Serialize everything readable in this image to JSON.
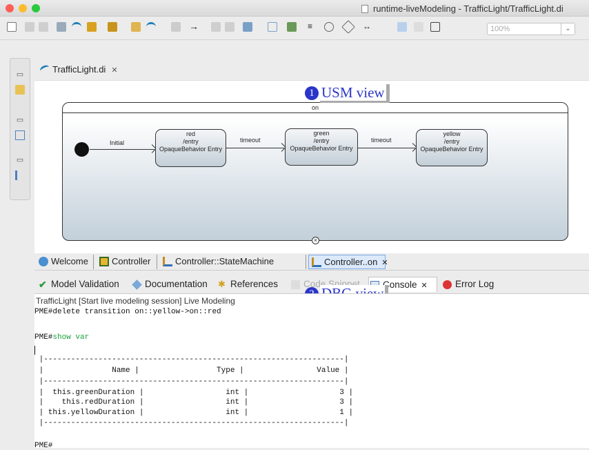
{
  "window": {
    "title": "runtime-liveModeling - TrafficLight/TrafficLight.di"
  },
  "window_controls": [
    {
      "name": "close",
      "color": "#fc5f57"
    },
    {
      "name": "minimize",
      "color": "#fdbc2e"
    },
    {
      "name": "maximize",
      "color": "#29c940"
    }
  ],
  "toolbar": {
    "zoom_value": "100%",
    "icons": [
      "new-icon",
      "save-icon",
      "save-all-icon",
      "edit-icon",
      "papyrus-icon",
      "diagram-icon",
      "table-icon",
      "view-icon",
      "papyrus-icon",
      "undo-icon",
      "arrow-icon",
      "copy-icon",
      "paste-icon",
      "layout-icon",
      "align-icon",
      "distribute-icon",
      "line-icon",
      "route-icon",
      "route-style-icon",
      "resize-icon",
      "color-icon",
      "font-icon",
      "grid-icon"
    ]
  },
  "sidebar": {
    "icons": [
      "restore-icon",
      "folder-icon",
      "restore-icon",
      "tree-icon",
      "restore-icon",
      "outline-icon"
    ]
  },
  "editor": {
    "tab_label": "TrafficLight.di"
  },
  "diagram": {
    "region_label": "on",
    "initial_label": "Initial",
    "transitions": [
      "timeout",
      "timeout"
    ],
    "states": [
      {
        "name": "red",
        "entry": "/entry",
        "behavior": "OpaqueBehavior Entry"
      },
      {
        "name": "green",
        "entry": "/entry",
        "behavior": "OpaqueBehavior Entry"
      },
      {
        "name": "yellow",
        "entry": "/entry",
        "behavior": "OpaqueBehavior Entry"
      }
    ]
  },
  "annotations": [
    {
      "number": "1",
      "label": "USM view"
    },
    {
      "number": "2",
      "label": "DBG view"
    }
  ],
  "editor_tabs": [
    {
      "label": "Welcome",
      "icon": "welcome-icon"
    },
    {
      "label": "Controller",
      "icon": "class-diagram-icon"
    },
    {
      "label": "Controller::StateMachine",
      "icon": "state-machine-icon"
    },
    {
      "label": "Controller..on",
      "icon": "state-machine-icon",
      "active": true
    }
  ],
  "view_tabs": [
    {
      "label": "Model Validation",
      "icon": "check-icon"
    },
    {
      "label": "Documentation",
      "icon": "doc-icon"
    },
    {
      "label": "References",
      "icon": "references-icon"
    },
    {
      "label": "Code Snippet",
      "icon": "snippet-icon"
    },
    {
      "label": "Console",
      "icon": "console-icon",
      "active": true
    },
    {
      "label": "Error Log",
      "icon": "error-log-icon"
    }
  ],
  "console": {
    "header": "TrafficLight [Start live modeling session] Live Modeling",
    "lines": [
      {
        "prompt": "PME#",
        "text": "delete transition on::yellow->on::red"
      },
      {
        "prompt": "",
        "text": ""
      },
      {
        "prompt": "PME#",
        "text": "show var",
        "highlight": true
      }
    ],
    "table": [
      " |------------------------------------------------------------------|",
      " |               Name |                 Type |                Value |",
      " |------------------------------------------------------------------|",
      " |  this.greenDuration |                  int |                    3 |",
      " |    this.redDuration |                  int |                    3 |",
      " | this.yellowDuration |                  int |                    1 |",
      " |------------------------------------------------------------------|"
    ],
    "final_prompt": "PME#"
  },
  "colors": {
    "accent": "#2b35c9",
    "console_green": "#19a33a",
    "active_tab": "#dbe9fb"
  }
}
